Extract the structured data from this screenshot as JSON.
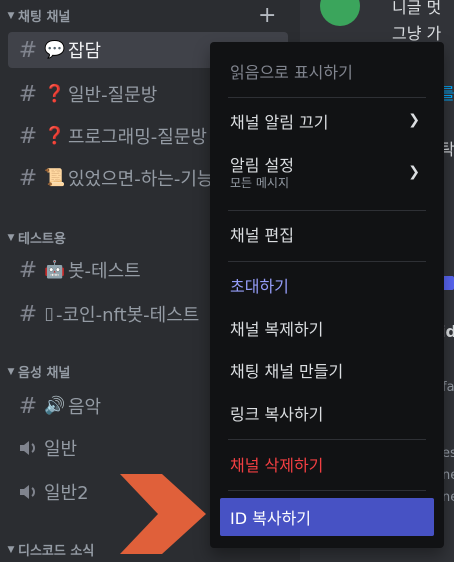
{
  "sidebar": {
    "categories": [
      {
        "label": "채팅 채널"
      },
      {
        "label": "테스트용"
      },
      {
        "label": "음성 채널"
      },
      {
        "label": "디스코드 소식"
      }
    ],
    "channels": [
      {
        "emoji": "💬",
        "name": "잡담"
      },
      {
        "emoji": "❓",
        "name": "일반-질문방"
      },
      {
        "emoji": "❓",
        "name": "프로그래밍-질문방"
      },
      {
        "emoji": "📜",
        "name": "있었으면-하는-기능"
      },
      {
        "emoji": "🤖",
        "name": "봇-테스트"
      },
      {
        "emoji": "▯",
        "name": "-코인-nft봇-테스트"
      },
      {
        "emoji": "🔊",
        "name": "음악"
      },
      {
        "emoji": "",
        "name": "일반"
      },
      {
        "emoji": "",
        "name": "일반2"
      }
    ]
  },
  "main": {
    "line1": "니글 멋",
    "line2": "그냥 가",
    "frag_a": "를",
    "frag_b": "탁",
    "frag_c": "ide",
    "frag_d": "fa",
    "frag_e": "es",
    "frag_f": "ne",
    "frag_g": "ne"
  },
  "menu": {
    "mark_read": "읽음으로 표시하기",
    "mute_channel": "채널 알림 끄기",
    "notif_settings": "알림 설정",
    "notif_settings_sub": "모든 메시지",
    "edit_channel": "채널 편집",
    "invite": "초대하기",
    "clone_channel": "채널 복제하기",
    "create_text": "채팅 채널 만들기",
    "copy_link": "링크 복사하기",
    "delete_channel": "채널 삭제하기",
    "copy_id": "ID 복사하기"
  },
  "colors": {
    "accent": "#4752c4",
    "danger": "#f23f42",
    "invite_blue": "#949cf7",
    "annotation_arrow": "#e0603a"
  }
}
